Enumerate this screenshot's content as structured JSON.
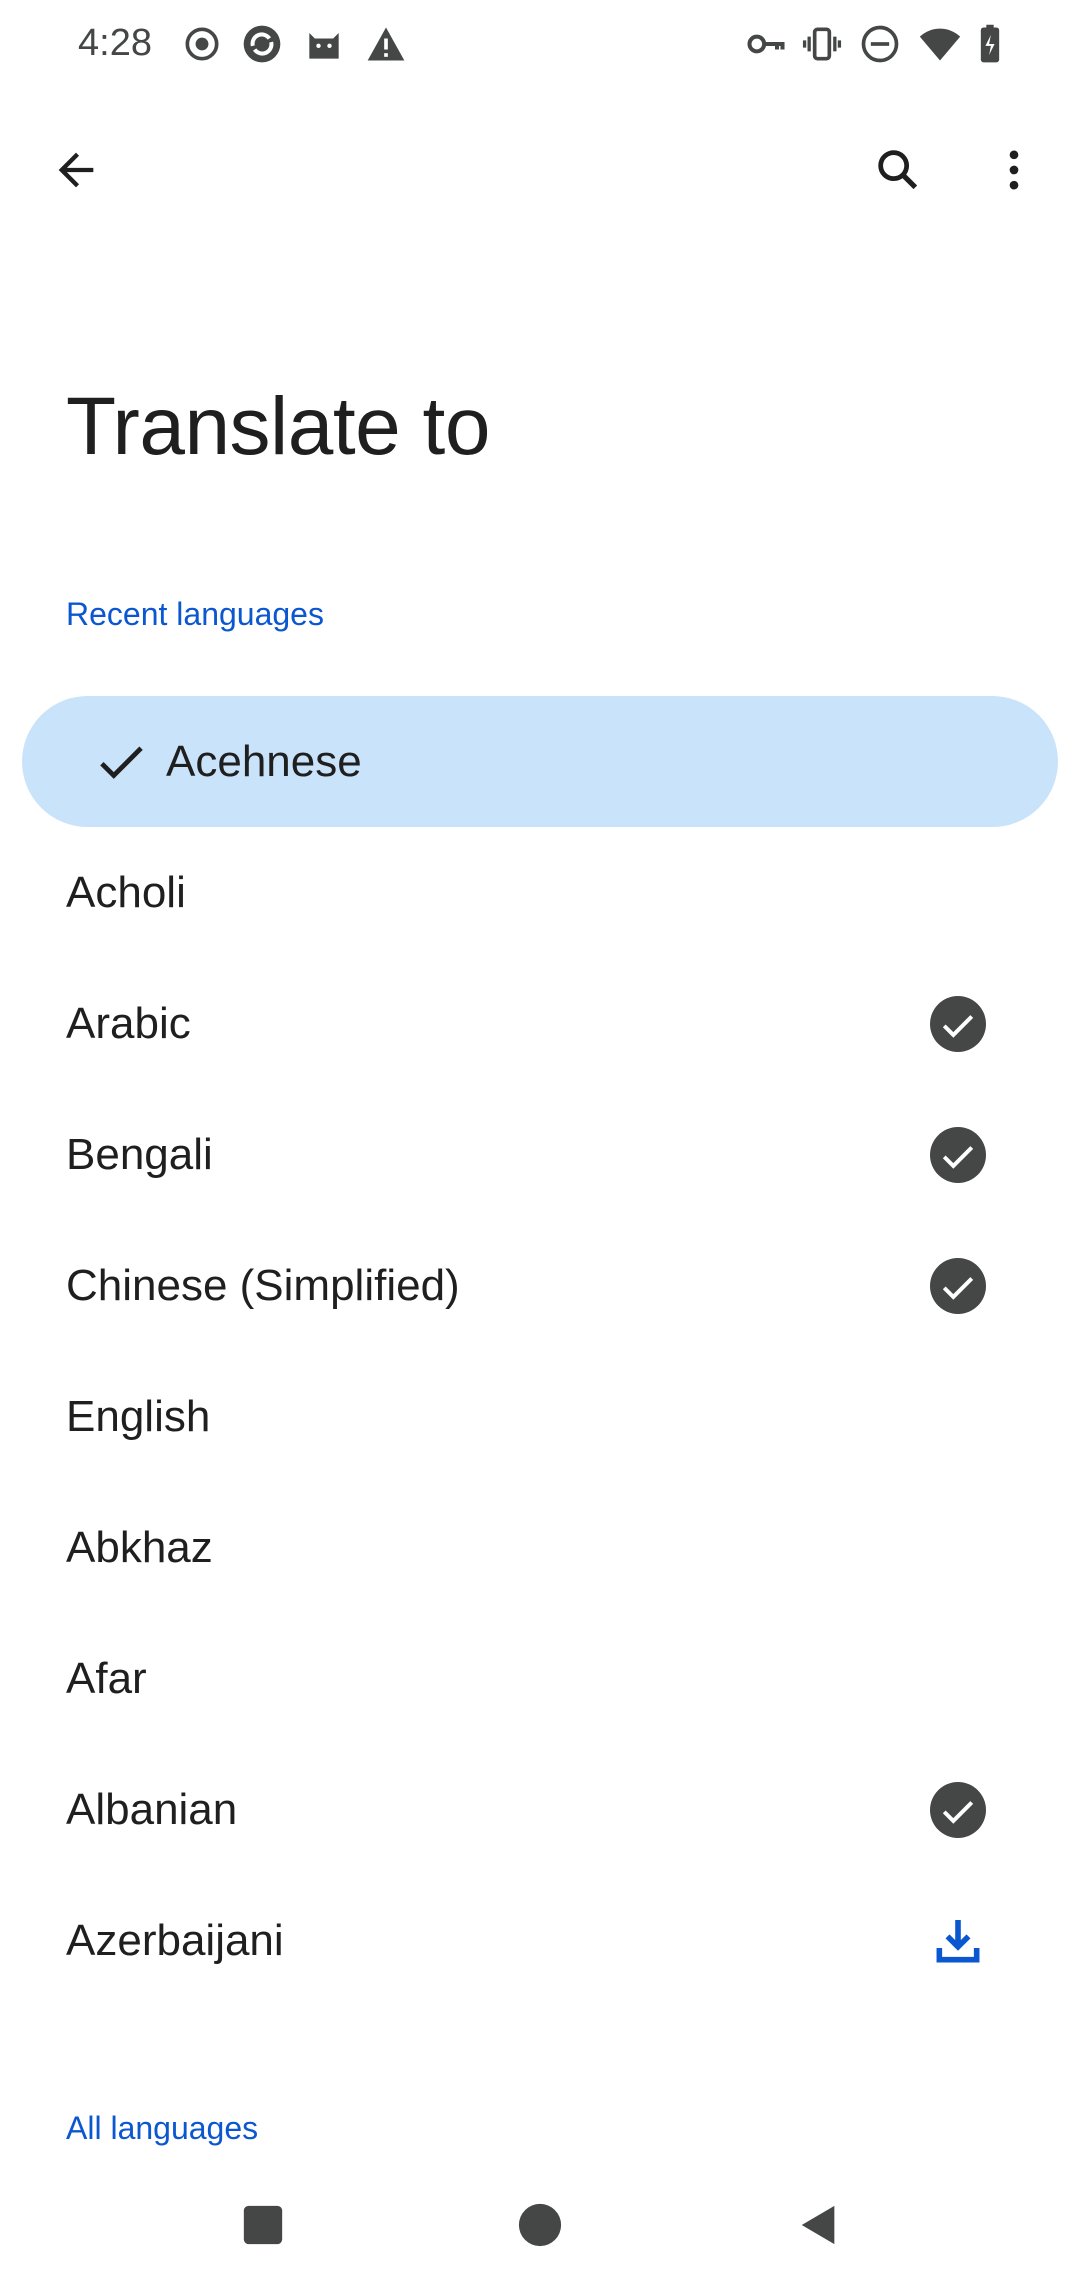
{
  "status_bar": {
    "time": "4:28",
    "left_icons": [
      "record-icon",
      "sync-app-icon",
      "cat-app-icon",
      "warning-icon"
    ],
    "right_icons": [
      "vpn-key-icon",
      "vibrate-icon",
      "do-not-disturb-icon",
      "wifi-icon",
      "battery-charging-icon"
    ]
  },
  "app_bar": {
    "back_icon": "arrow-back-icon",
    "search_icon": "search-icon",
    "more_icon": "more-vert-icon"
  },
  "page": {
    "title": "Translate to"
  },
  "recent": {
    "header": "Recent languages",
    "items": [
      {
        "label": "Acehnese",
        "selected": true,
        "status": "none"
      },
      {
        "label": "Acholi",
        "selected": false,
        "status": "none"
      },
      {
        "label": "Arabic",
        "selected": false,
        "status": "downloaded"
      },
      {
        "label": "Bengali",
        "selected": false,
        "status": "downloaded"
      },
      {
        "label": "Chinese (Simplified)",
        "selected": false,
        "status": "downloaded"
      },
      {
        "label": "English",
        "selected": false,
        "status": "none"
      },
      {
        "label": "Abkhaz",
        "selected": false,
        "status": "none"
      },
      {
        "label": "Afar",
        "selected": false,
        "status": "none"
      },
      {
        "label": "Albanian",
        "selected": false,
        "status": "downloaded"
      },
      {
        "label": "Azerbaijani",
        "selected": false,
        "status": "download-available"
      }
    ]
  },
  "all": {
    "header": "All languages"
  },
  "colors": {
    "accent": "#0b57d0",
    "selected_bg": "#c9e3fa",
    "badge_dark": "#444746",
    "text": "#1f1f1f"
  },
  "nav_bar": {
    "recents_icon": "square-recents-icon",
    "home_icon": "circle-home-icon",
    "back_icon": "triangle-back-icon"
  }
}
